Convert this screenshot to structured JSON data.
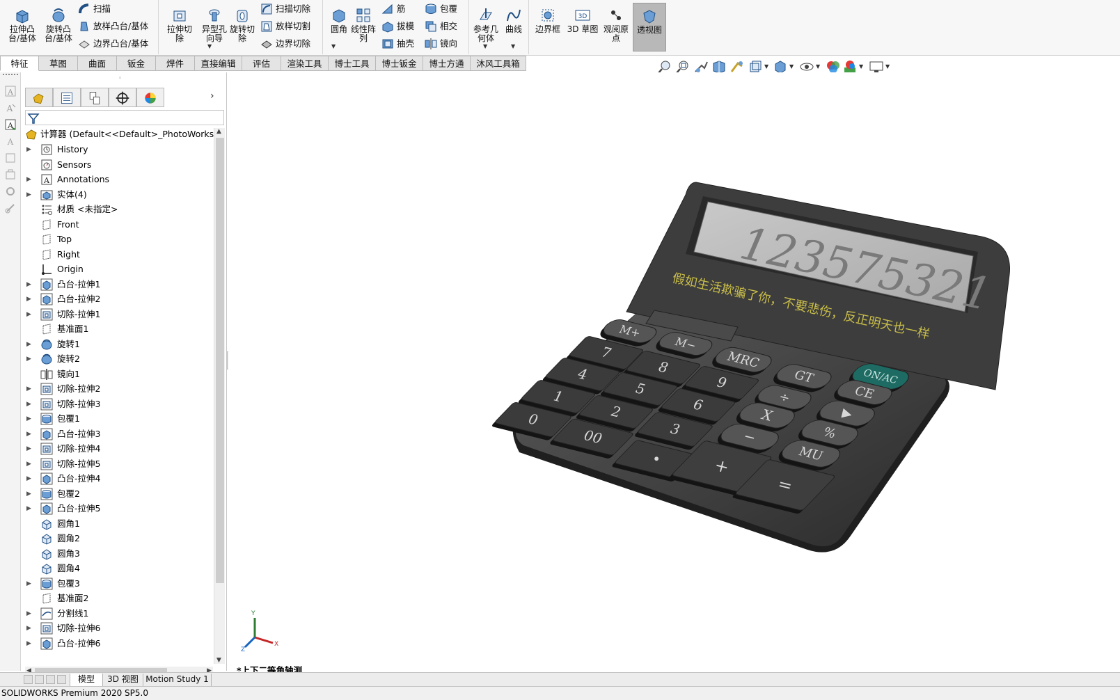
{
  "ribbon": {
    "extrude_boss": "拉伸凸\n台/基体",
    "revolve_boss": "旋转凸\n台/基体",
    "sweep": "扫描",
    "loft_boss": "放样凸台/基体",
    "boundary_boss": "边界凸台/基体",
    "extrude_cut": "拉伸切\n除",
    "hole_wizard": "异型孔\n向导",
    "revolve_cut": "旋转切\n除",
    "swept_cut": "扫描切除",
    "lofted_cut": "放样切割",
    "boundary_cut": "边界切除",
    "fillet": "圆角",
    "linear_pattern": "线性阵\n列",
    "rib": "筋",
    "draft": "拔模",
    "shell": "抽壳",
    "wrap": "包覆",
    "intersect": "相交",
    "mirror": "镜向",
    "ref_geometry": "参考几\n何体",
    "curves": "曲线",
    "bounding_box": "边界框",
    "sketch3d": "3D 草图",
    "viewpoint": "观阅原\n点",
    "perspective": "透视图"
  },
  "command_tabs": [
    "特征",
    "草图",
    "曲面",
    "钣金",
    "焊件",
    "直接编辑",
    "评估",
    "渲染工具",
    "博士工具",
    "博士钣金",
    "博士方通",
    "沐风工具箱"
  ],
  "feature_tree": {
    "root": "计算器  (Default<<Default>_PhotoWorks Di",
    "items": [
      {
        "label": "History",
        "icon": "history-icon",
        "expand": true
      },
      {
        "label": "Sensors",
        "icon": "sensors-icon",
        "expand": false
      },
      {
        "label": "Annotations",
        "icon": "annotations-icon",
        "expand": true
      },
      {
        "label": "实体(4)",
        "icon": "solid-bodies-icon",
        "expand": true
      },
      {
        "label": "材质 <未指定>",
        "icon": "material-icon",
        "expand": false
      },
      {
        "label": "Front",
        "icon": "plane-icon",
        "expand": false
      },
      {
        "label": "Top",
        "icon": "plane-icon",
        "expand": false
      },
      {
        "label": "Right",
        "icon": "plane-icon",
        "expand": false
      },
      {
        "label": "Origin",
        "icon": "origin-icon",
        "expand": false
      },
      {
        "label": "凸台-拉伸1",
        "icon": "boss-extrude-icon",
        "expand": true
      },
      {
        "label": "凸台-拉伸2",
        "icon": "boss-extrude-icon",
        "expand": true
      },
      {
        "label": "切除-拉伸1",
        "icon": "cut-extrude-icon",
        "expand": true
      },
      {
        "label": "基准面1",
        "icon": "plane-icon",
        "expand": false
      },
      {
        "label": "旋转1",
        "icon": "revolve-icon",
        "expand": true
      },
      {
        "label": "旋转2",
        "icon": "revolve-icon",
        "expand": true
      },
      {
        "label": "镜向1",
        "icon": "mirror-icon",
        "expand": false
      },
      {
        "label": "切除-拉伸2",
        "icon": "cut-extrude-icon",
        "expand": true
      },
      {
        "label": "切除-拉伸3",
        "icon": "cut-extrude-icon",
        "expand": true
      },
      {
        "label": "包覆1",
        "icon": "wrap-icon",
        "expand": true
      },
      {
        "label": "凸台-拉伸3",
        "icon": "boss-extrude-icon",
        "expand": true
      },
      {
        "label": "切除-拉伸4",
        "icon": "cut-extrude-icon",
        "expand": true
      },
      {
        "label": "切除-拉伸5",
        "icon": "cut-extrude-icon",
        "expand": true
      },
      {
        "label": "凸台-拉伸4",
        "icon": "boss-extrude-icon",
        "expand": true
      },
      {
        "label": "包覆2",
        "icon": "wrap-icon",
        "expand": true
      },
      {
        "label": "凸台-拉伸5",
        "icon": "boss-extrude-icon",
        "expand": true
      },
      {
        "label": "圆角1",
        "icon": "fillet-icon",
        "expand": false
      },
      {
        "label": "圆角2",
        "icon": "fillet-icon",
        "expand": false
      },
      {
        "label": "圆角3",
        "icon": "fillet-icon",
        "expand": false
      },
      {
        "label": "圆角4",
        "icon": "fillet-icon",
        "expand": false
      },
      {
        "label": "包覆3",
        "icon": "wrap-icon",
        "expand": true
      },
      {
        "label": "基准面2",
        "icon": "plane-icon",
        "expand": false
      },
      {
        "label": "分割线1",
        "icon": "split-line-icon",
        "expand": true
      },
      {
        "label": "切除-拉伸6",
        "icon": "cut-extrude-icon",
        "expand": true
      },
      {
        "label": "凸台-拉伸6",
        "icon": "boss-extrude-icon",
        "expand": true
      }
    ]
  },
  "model": {
    "display_digits": "123575321",
    "motto": "假如生活欺骗了你，不要悲伤，反正明天也一样",
    "keys": {
      "mplus": "M+",
      "mminus": "M−",
      "mrc": "MRC",
      "gt": "GT",
      "onac": "ON/AC",
      "div": "÷",
      "ce": "CE",
      "mul": "X",
      "arrow": "▶",
      "minus": "−",
      "pct": "%",
      "mu": "MU",
      "plus": "+",
      "eq": "=",
      "k7": "7",
      "k8": "8",
      "k9": "9",
      "k4": "4",
      "k5": "5",
      "k6": "6",
      "k1": "1",
      "k2": "2",
      "k3": "3",
      "k0": "0",
      "k00": "00",
      "kdot": "•"
    }
  },
  "triad": {
    "x": "X",
    "y": "Y",
    "z": "Z"
  },
  "view_name": "*上下二等角轴测",
  "bottom_tabs": [
    "模型",
    "3D 视图",
    "Motion Study 1"
  ],
  "status": "SOLIDWORKS Premium 2020 SP5.0",
  "colors": {
    "accent_active_btn": "#b8b8b8",
    "on_key": "#1d6b63",
    "display_text": "#777777",
    "motto_text": "#c8bd49"
  }
}
